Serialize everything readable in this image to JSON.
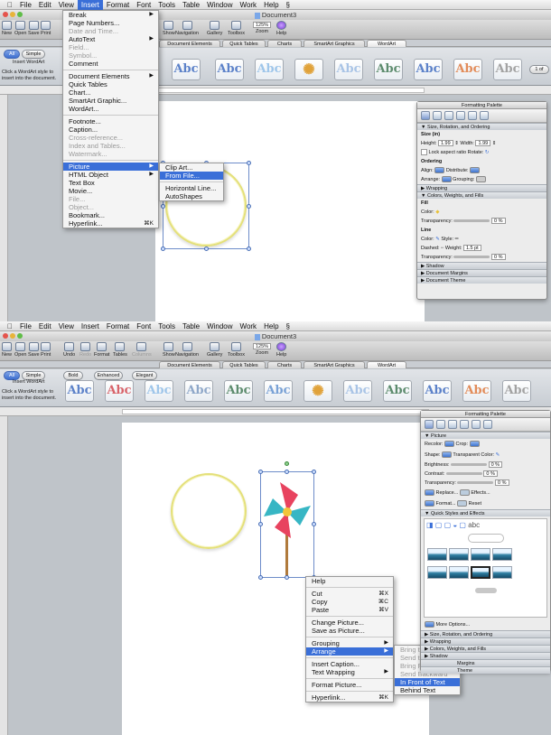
{
  "menubar": [
    "File",
    "Edit",
    "View",
    "Insert",
    "Format",
    "Font",
    "Tools",
    "Table",
    "Window",
    "Work",
    "Help"
  ],
  "doc_title": "Document3",
  "toolbar": {
    "top": [
      "New",
      "Open",
      "Save",
      "Print",
      "Show",
      "Navigation",
      "Gallery",
      "Toolbox",
      "Zoom",
      "Help"
    ],
    "bottom": [
      "New",
      "Open",
      "Save",
      "Print",
      "Undo",
      "Redo",
      "Format",
      "Tables",
      "Columns",
      "Show",
      "Navigation",
      "Gallery",
      "Toolbox",
      "Zoom",
      "Help"
    ],
    "zoom": "125%"
  },
  "ribbon_tabs": [
    "Document Elements",
    "Quick Tables",
    "Charts",
    "SmartArt Graphics",
    "WordArt"
  ],
  "wordart": {
    "heading": "Insert WordArt",
    "hint_top": [
      "Click a WordArt style to",
      "insert into the document."
    ],
    "hint_bottom": [
      "Click a WordArt style to",
      "insert into the document."
    ],
    "filters_top": [
      "All",
      "Simple"
    ],
    "filters_bottom": [
      "All",
      "Simple",
      "Bold",
      "Enhanced",
      "Elegant"
    ],
    "sample": "Abc",
    "page_of_top": "1 of"
  },
  "insert_menu": {
    "items": [
      {
        "label": "Break",
        "sub": true
      },
      {
        "label": "Page Numbers..."
      },
      {
        "label": "Date and Time...",
        "dim": true
      },
      {
        "label": "AutoText",
        "sub": true
      },
      {
        "label": "Field...",
        "dim": true
      },
      {
        "label": "Symbol...",
        "dim": true
      },
      {
        "label": "Comment"
      },
      {
        "sep": true
      },
      {
        "label": "Document Elements",
        "sub": true
      },
      {
        "label": "Quick Tables"
      },
      {
        "label": "Chart..."
      },
      {
        "label": "SmartArt Graphic..."
      },
      {
        "label": "WordArt..."
      },
      {
        "sep": true
      },
      {
        "label": "Footnote..."
      },
      {
        "label": "Caption..."
      },
      {
        "label": "Cross-reference...",
        "dim": true
      },
      {
        "label": "Index and Tables...",
        "dim": true
      },
      {
        "label": "Watermark...",
        "dim": true
      },
      {
        "sep": true
      },
      {
        "label": "Picture",
        "sub": true,
        "on": true
      },
      {
        "label": "HTML Object",
        "sub": true
      },
      {
        "label": "Text Box"
      },
      {
        "label": "Movie..."
      },
      {
        "label": "File...",
        "dim": true
      },
      {
        "label": "Object...",
        "dim": true
      },
      {
        "label": "Bookmark..."
      },
      {
        "label": "Hyperlink...",
        "sc": "⌘K"
      }
    ]
  },
  "picture_submenu": {
    "items": [
      {
        "label": "Clip Art..."
      },
      {
        "label": "From File...",
        "on": true
      },
      {
        "sep": true
      },
      {
        "label": "Horizontal Line..."
      },
      {
        "label": "AutoShapes"
      }
    ]
  },
  "palette_top": {
    "title": "Formatting Palette",
    "sections": [
      "Size, Rotation, and Ordering",
      "Wrapping",
      "Colors, Weights, and Fills",
      "Shadow",
      "Document Margins",
      "Document Theme"
    ],
    "size_label": "Size (in)",
    "height_label": "Height:",
    "height_val": "1.99",
    "width_label": "Width:",
    "width_val": "1.99",
    "lock_label": "Lock aspect ratio",
    "rotate_label": "Rotate:",
    "ordering_label": "Ordering",
    "align_label": "Align:",
    "distribute_label": "Distribute:",
    "arrange_label": "Arrange:",
    "grouping_label": "Grouping:",
    "fill_label": "Fill",
    "color_label": "Color:",
    "transparency_label": "Transparency:",
    "transparency_val": "0 %",
    "line_label": "Line",
    "style_label": "Style:",
    "dashed_label": "Dashed:",
    "weight_label": "Weight:",
    "weight_val": "1.5 pt",
    "transparency2_val": "0 %"
  },
  "palette_bottom": {
    "title": "Formatting Palette",
    "picture_section": "Picture",
    "recolor_label": "Recolor:",
    "crop_label": "Crop:",
    "shape_label": "Shape:",
    "transparent_label": "Transparent Color:",
    "brightness_label": "Brightness:",
    "brightness_val": "0 %",
    "contrast_label": "Contrast:",
    "contrast_val": "0 %",
    "transparency_label": "Transparency:",
    "transparency_val": "0 %",
    "replace_label": "Replace...",
    "effects_label": "Effects...",
    "format_label": "Format...",
    "reset_label": "Reset",
    "quick_styles": "Quick Styles and Effects",
    "more_options": "More Options...",
    "sections": [
      "Size, Rotation, and Ordering",
      "Wrapping",
      "Colors, Weights, and Fills",
      "Shadow",
      "Margins",
      "Theme"
    ]
  },
  "context_menu": {
    "items": [
      {
        "label": "Help"
      },
      {
        "sep": true
      },
      {
        "label": "Cut",
        "sc": "⌘X"
      },
      {
        "label": "Copy",
        "sc": "⌘C"
      },
      {
        "label": "Paste",
        "sc": "⌘V"
      },
      {
        "sep": true
      },
      {
        "label": "Change Picture..."
      },
      {
        "label": "Save as Picture..."
      },
      {
        "sep": true
      },
      {
        "label": "Grouping",
        "sub": true
      },
      {
        "label": "Arrange",
        "sub": true,
        "on": true
      },
      {
        "sep": true
      },
      {
        "label": "Insert Caption..."
      },
      {
        "label": "Text Wrapping",
        "sub": true
      },
      {
        "sep": true
      },
      {
        "label": "Format Picture..."
      },
      {
        "sep": true
      },
      {
        "label": "Hyperlink...",
        "sc": "⌘K"
      }
    ]
  },
  "arrange_submenu": {
    "items": [
      {
        "label": "Bring to Front",
        "dim": true
      },
      {
        "label": "Send to Back",
        "dim": true
      },
      {
        "label": "Bring Forward",
        "dim": true
      },
      {
        "label": "Send Backward",
        "dim": true
      },
      {
        "label": "In Front of Text",
        "on": true
      },
      {
        "label": "Behind Text"
      }
    ]
  },
  "colors": {
    "accent": "#3a6fd8",
    "ring": "#e4e07a",
    "pinwheel_pink": "#e8435f",
    "pinwheel_teal": "#37b6c4",
    "stick": "#b07a3c"
  }
}
